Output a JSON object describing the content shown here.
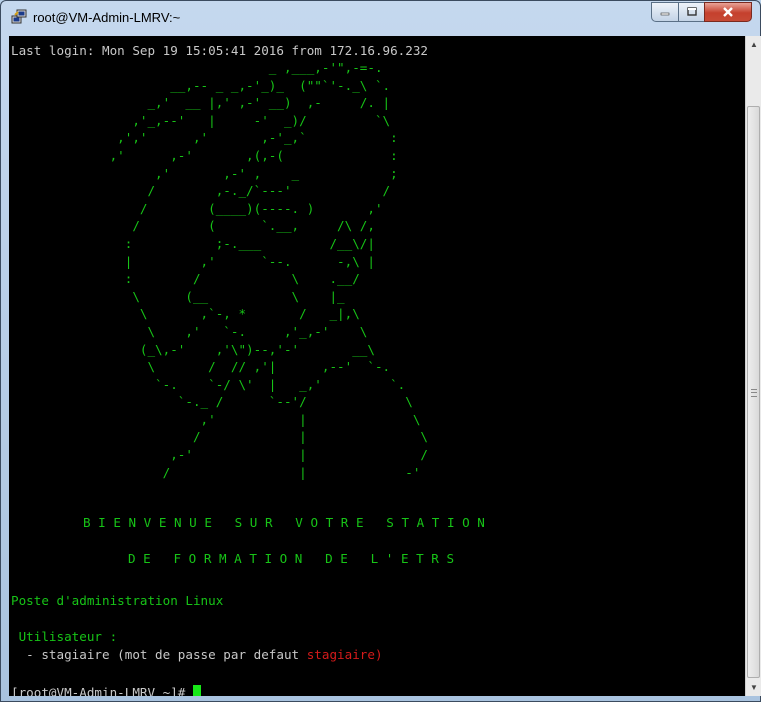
{
  "window": {
    "title": "root@VM-Admin-LMRV:~",
    "icon": "putty-icon",
    "controls": [
      "minimize",
      "maximize",
      "close"
    ]
  },
  "terminal": {
    "login_line": "Last login: Mon Sep 19 15:05:41 2016 from 172.16.96.232",
    "ascii_art": "                                  _ ,___,-'\",-=-.\n                     __,-- _ _,-'_)_  (\"\"`'-._\\ `.\n                  _,'  __ |,' ,-' __)  ,-     /. |\n                ,'_,--'   |     -'  _)/         `\\\n              ,','      ,'       ,-'_,`           :\n             ,'      ,-'       ,(,-(              :\n                   ,'       ,-' ,    _            ;\n                  /        ,-._/`---'            /\n                 /        (____)(----. )       ,'\n                /         (      `.__,     /\\ /,\n               :           ;-.___         /__\\/|\n               |         ,'      `--.      -,\\ |\n               :        /            \\    .__/\n                \\      (__           \\    |_\n                 \\       ,`-, *       /   _|,\\\n                  \\    ,'   `-.     ,'_,-'    \\\n                 (_\\,-'    ,'\\\")--,'-'       __\\\n                  \\       /  // ,'|      ,--'  `-.\n                   `-.    `-/ \\'  |   _,'         `.\n                      `-._ /      `--'/             \\\n                         ,'           |              \\\n                        /             |               \\\n                     ,-'              |               /\n                    /                 |             -'",
    "welcome_line1": "B I E N V E N U E   S U R   V O T R E   S T A T I O N",
    "welcome_line2": "D E   F O R M A T I O N   D E   L ' E T R S",
    "poste": "Poste d'administration Linux",
    "utilisateur_label": "Utilisateur :",
    "user_line_prefix": "  - stagiaire (mot de passe par defaut ",
    "default_password": "stagiaire",
    "user_line_suffix": ")",
    "prompt": "[root@VM-Admin-LMRV ~]# "
  },
  "colors": {
    "terminal_bg": "#000000",
    "text_white": "#c8c8c8",
    "text_green": "#17c417",
    "text_red": "#d41a1a",
    "cursor": "#17e817"
  }
}
